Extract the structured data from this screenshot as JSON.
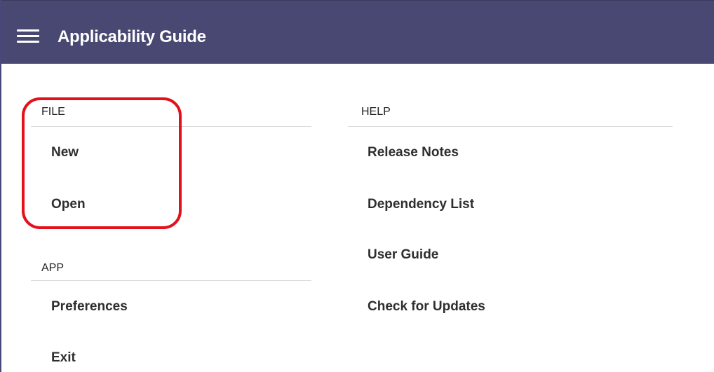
{
  "app": {
    "title": "Applicability Guide",
    "menu_icon": "hamburger-menu-icon",
    "colors": {
      "titlebar": "#494872",
      "highlight": "#e3111c"
    }
  },
  "sections": {
    "file": {
      "header": "FILE",
      "items": [
        "New",
        "Open"
      ]
    },
    "app": {
      "header": "APP",
      "items": [
        "Preferences",
        "Exit"
      ]
    },
    "help": {
      "header": "HELP",
      "items": [
        "Release Notes",
        "Dependency List",
        "User Guide",
        "Check for Updates"
      ]
    }
  }
}
